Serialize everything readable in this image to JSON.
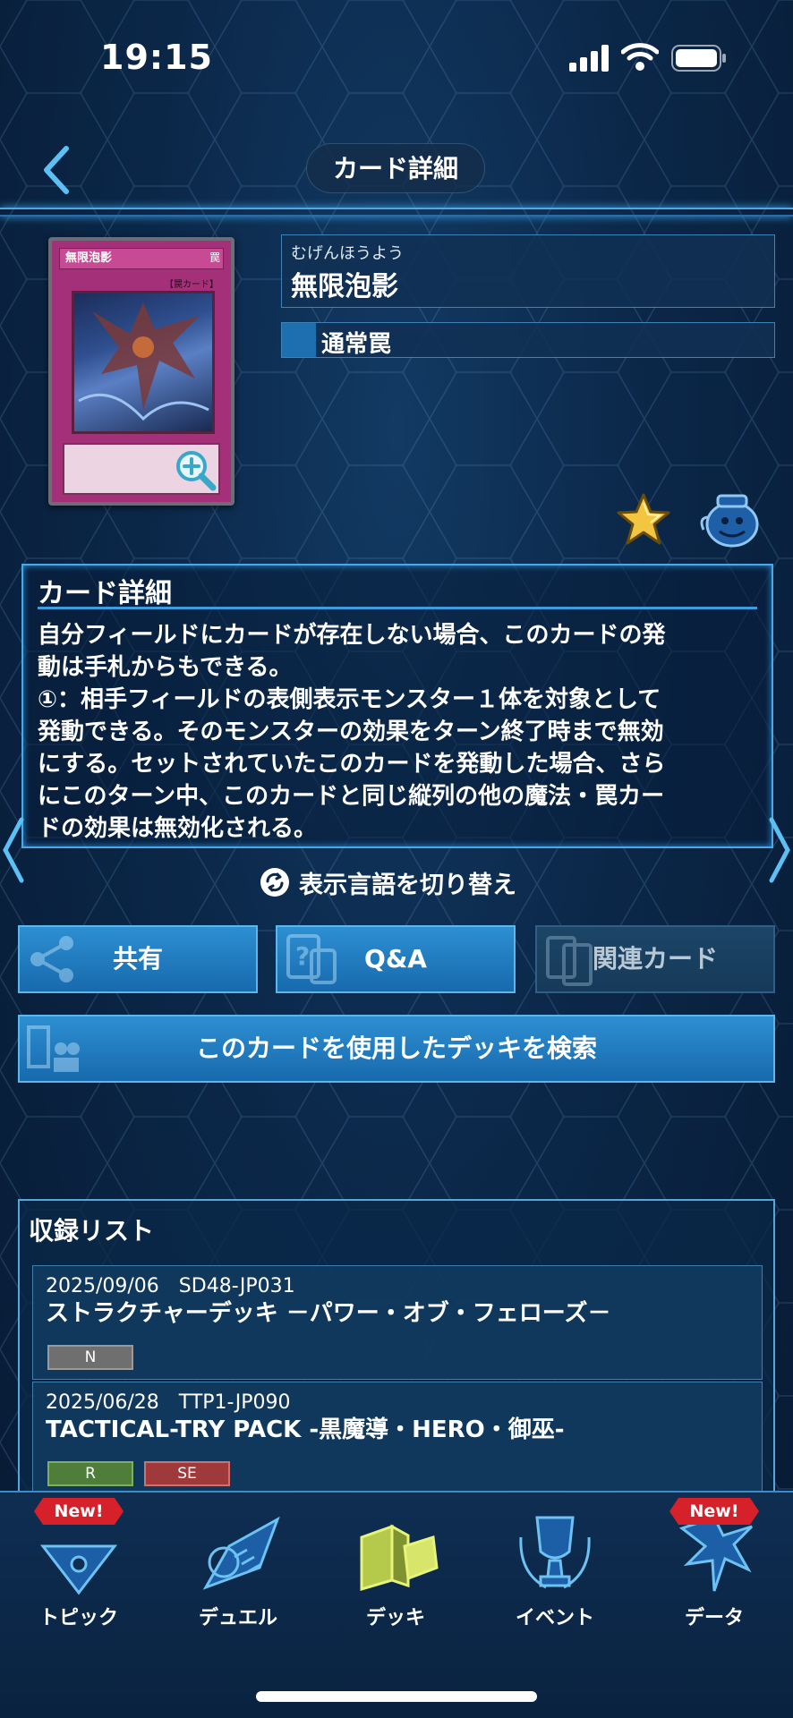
{
  "status": {
    "time": "19:15"
  },
  "header": {
    "title": "カード詳細"
  },
  "card": {
    "ruby": "むげんほうよう",
    "name": "無限泡影",
    "type": "通常罠",
    "art_name": "無限泡影",
    "art_attr": "罠",
    "art_type_tag": "【罠カード】"
  },
  "description": {
    "heading": "カード詳細",
    "text": "自分フィールドにカードが存在しない場合、このカードの発\n動は手札からもできる。\n①：相手フィールドの表側表示モンスター１体を対象として\n発動できる。そのモンスターの効果をターン終了時まで無効\nにする。セットされていたこのカードを発動した場合、さら\nにこのターン中、このカードと同じ縦列の他の魔法・罠カー\nドの効果は無効化される。"
  },
  "lang_toggle": "表示言語を切り替え",
  "buttons": {
    "share": "共有",
    "qa": "Q&A",
    "related": "関連カード",
    "deck_search": "このカードを使用したデッキを検索"
  },
  "release_list": {
    "heading": "収録リスト",
    "items": [
      {
        "meta": "2025/09/06　SD48-JP031",
        "name": "ストラクチャーデッキ －パワー・オブ・フェローズ－",
        "rarities": [
          "N"
        ]
      },
      {
        "meta": "2025/06/28　TTP1-JP090",
        "name": "TACTICAL-TRY PACK -黒魔導・HERO・御巫-",
        "rarities": [
          "R",
          "SE"
        ]
      }
    ]
  },
  "nav": {
    "new_badge": "New!",
    "tabs": [
      {
        "label": "トピック"
      },
      {
        "label": "デュエル"
      },
      {
        "label": "デッキ"
      },
      {
        "label": "イベント"
      },
      {
        "label": "データ"
      }
    ]
  },
  "colors": {
    "accent": "#2d8fd2",
    "card_trap": "#a4307a",
    "badge_red": "#d6202a"
  }
}
